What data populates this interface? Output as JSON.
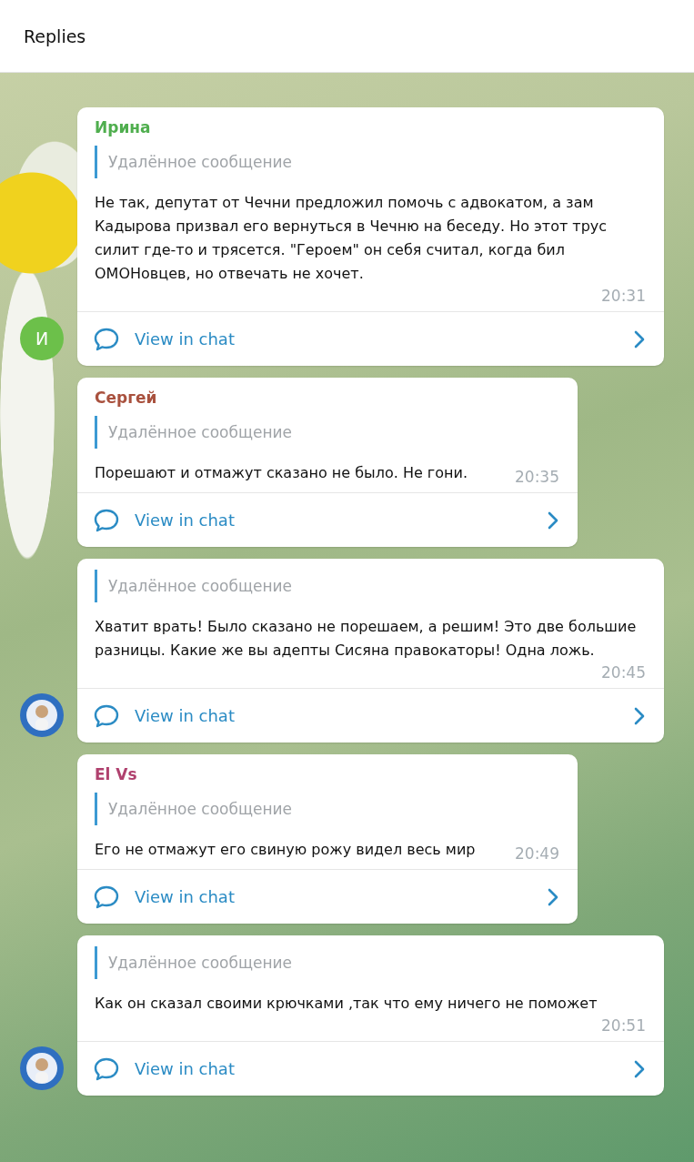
{
  "header": {
    "title": "Replies"
  },
  "messages": [
    {
      "sender": "Ирина",
      "color": "#4fae4e",
      "quote": "Удалённое сообщение",
      "text": "Не так, депутат от Чечни предложил помочь с адвокатом, а зам Кадырова призвал его вернуться в Чечню на беседу. Но этот трус силит где-то и трясется. \"Героем\" он себя считал, когда бил ОМОНовцев, но отвечать не хочет.",
      "time": "20:31",
      "action": "View in chat",
      "avatar": {
        "kind": "letter",
        "letter": "И",
        "color": "#6cc04a"
      }
    },
    {
      "sender": "Сергей",
      "color": "#a9513e",
      "quote": "Удалённое сообщение",
      "text": "Порешают и отмажут сказано не было. Не гони.",
      "time": "20:35",
      "action": "View in chat",
      "avatar": {
        "kind": "none"
      }
    },
    {
      "quote": "Удалённое сообщение",
      "text": "Хватит врать! Было сказано не порешаем, а решим! Это две большие разницы. Какие же вы адепты Сисяна правокаторы! Одна ложь.",
      "time": "20:45",
      "action": "View in chat",
      "avatar": {
        "kind": "picture"
      }
    },
    {
      "sender": "El Vs",
      "color": "#b0416e",
      "quote": "Удалённое сообщение",
      "text": "Его не отмажут его свиную рожу видел весь мир",
      "time": "20:49",
      "action": "View in chat",
      "avatar": {
        "kind": "none"
      }
    },
    {
      "quote": "Удалённое сообщение",
      "text": "Как он сказал  своими крючками ,так что ему ничего не поможет",
      "time": "20:51",
      "action": "View in chat",
      "avatar": {
        "kind": "picture"
      }
    }
  ]
}
